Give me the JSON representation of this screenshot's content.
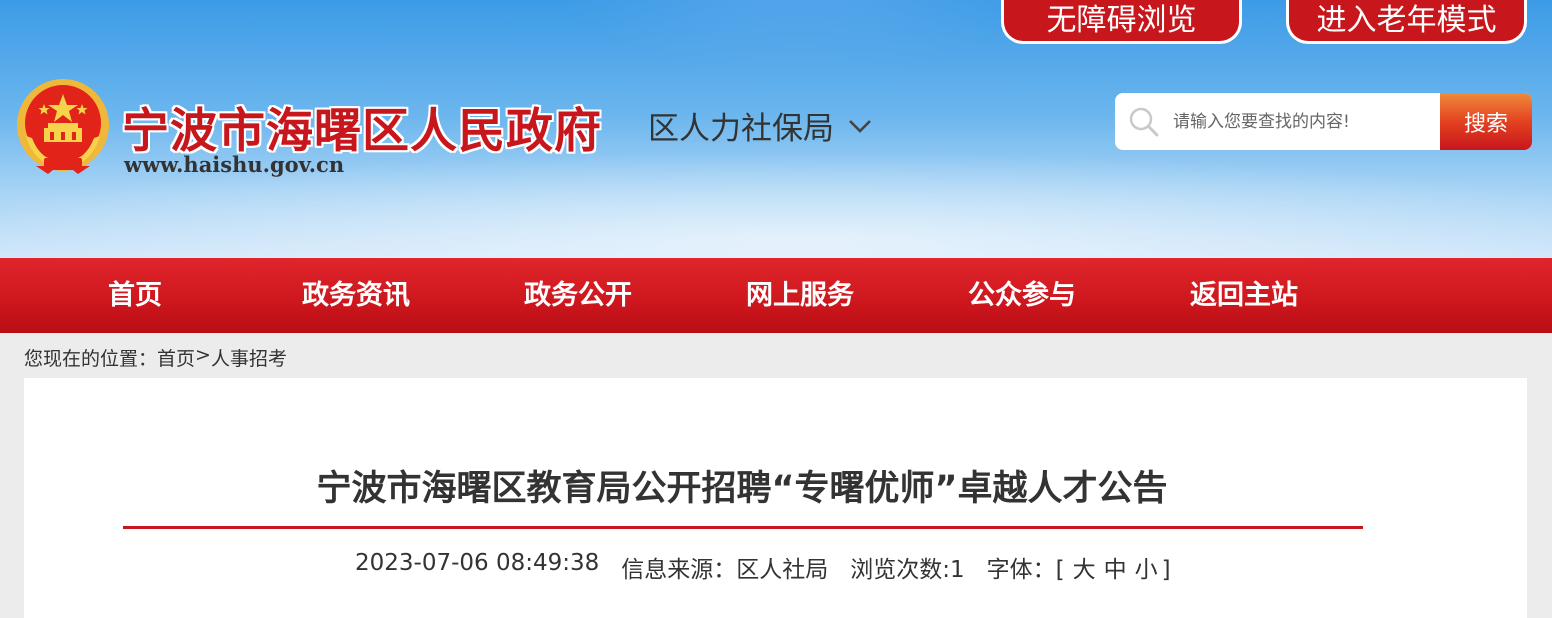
{
  "header": {
    "accessible_btn": "无障碍浏览",
    "elder_btn": "进入老年模式",
    "site_title": "宁波市海曙区人民政府",
    "site_url": "www.haishu.gov.cn",
    "dept": "区人力社保局",
    "emblem_icon": "national-emblem-icon",
    "search": {
      "placeholder": "请输入您要查找的内容!",
      "button": "搜索"
    }
  },
  "nav": {
    "items": [
      "首页",
      "政务资讯",
      "政务公开",
      "网上服务",
      "公众参与",
      "返回主站"
    ]
  },
  "breadcrumb": {
    "prefix": "您现在的位置：",
    "home": "首页",
    "sep": ">",
    "current": "人事招考"
  },
  "article": {
    "title": "宁波市海曙区教育局公开招聘“专曙优师”卓越人才公告",
    "datetime": "2023-07-06 08:49:38",
    "source": "信息来源：区人社局",
    "views": "浏览次数:1",
    "font_label": "字体：[",
    "font_large": "大",
    "font_medium": "中",
    "font_small": "小",
    "font_close": "]"
  },
  "colors": {
    "brand_red": "#c8161d",
    "sky_blue": "#3c9be6"
  }
}
